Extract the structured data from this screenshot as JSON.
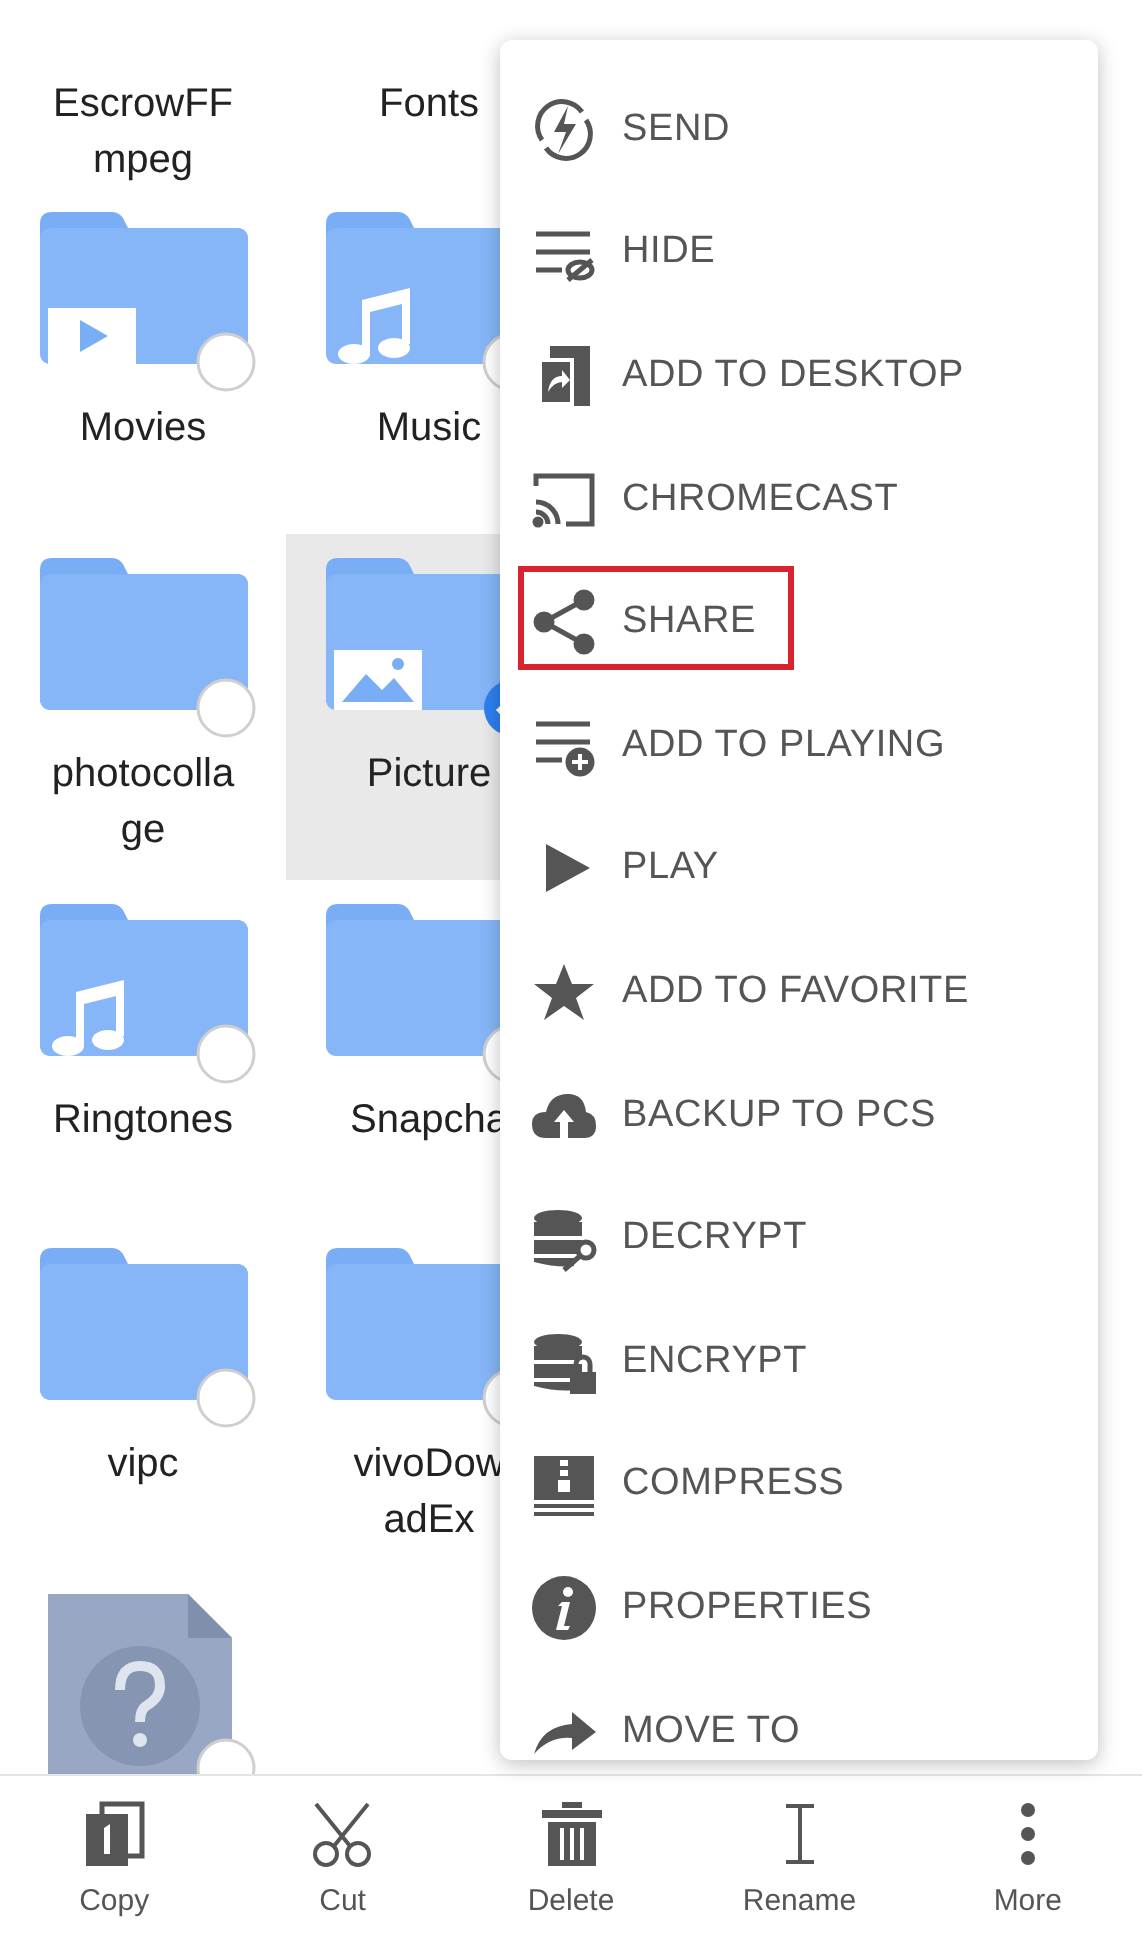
{
  "grid": {
    "rows": [
      {
        "kind": "label-only",
        "items": [
          {
            "lines": [
              "EscrowFF",
              "mpeg"
            ]
          },
          {
            "lines": [
              "Fonts"
            ]
          }
        ]
      },
      {
        "kind": "full",
        "items": [
          {
            "kind": "video-folder",
            "lines": [
              "Movies"
            ],
            "selected": false
          },
          {
            "kind": "music-folder",
            "lines": [
              "Music"
            ],
            "selected": false
          }
        ]
      },
      {
        "kind": "full",
        "items": [
          {
            "kind": "folder",
            "lines": [
              "photocolla",
              "ge"
            ],
            "selected": false
          },
          {
            "kind": "image-folder",
            "lines": [
              "Picture"
            ],
            "selected": true
          }
        ]
      },
      {
        "kind": "full",
        "items": [
          {
            "kind": "music-folder",
            "lines": [
              "Ringtones"
            ],
            "selected": false
          },
          {
            "kind": "folder",
            "lines": [
              "Snapcha"
            ],
            "selected": false
          }
        ]
      },
      {
        "kind": "full",
        "items": [
          {
            "kind": "folder",
            "lines": [
              "vipc"
            ],
            "selected": false
          },
          {
            "kind": "folder",
            "lines": [
              "vivoDow",
              "adEx"
            ],
            "selected": false
          }
        ]
      },
      {
        "kind": "full",
        "items": [
          {
            "kind": "file",
            "selected": false
          }
        ]
      }
    ]
  },
  "menu": {
    "items": [
      {
        "label": "SEND",
        "highlighted": false
      },
      {
        "label": "HIDE",
        "highlighted": false
      },
      {
        "label": "ADD TO DESKTOP",
        "highlighted": false
      },
      {
        "label": "CHROMECAST",
        "highlighted": false
      },
      {
        "label": "SHARE",
        "highlighted": true
      },
      {
        "label": "ADD TO PLAYING",
        "highlighted": false
      },
      {
        "label": "PLAY",
        "highlighted": false
      },
      {
        "label": "ADD TO FAVORITE",
        "highlighted": false
      },
      {
        "label": "BACKUP TO PCS",
        "highlighted": false
      },
      {
        "label": "DECRYPT",
        "highlighted": false
      },
      {
        "label": "ENCRYPT",
        "highlighted": false
      },
      {
        "label": "COMPRESS",
        "highlighted": false
      },
      {
        "label": "PROPERTIES",
        "highlighted": false
      },
      {
        "label": "MOVE TO",
        "highlighted": false
      }
    ]
  },
  "toolbar": [
    {
      "label": "Copy"
    },
    {
      "label": "Cut"
    },
    {
      "label": "Delete"
    },
    {
      "label": "Rename"
    },
    {
      "label": "More"
    }
  ]
}
